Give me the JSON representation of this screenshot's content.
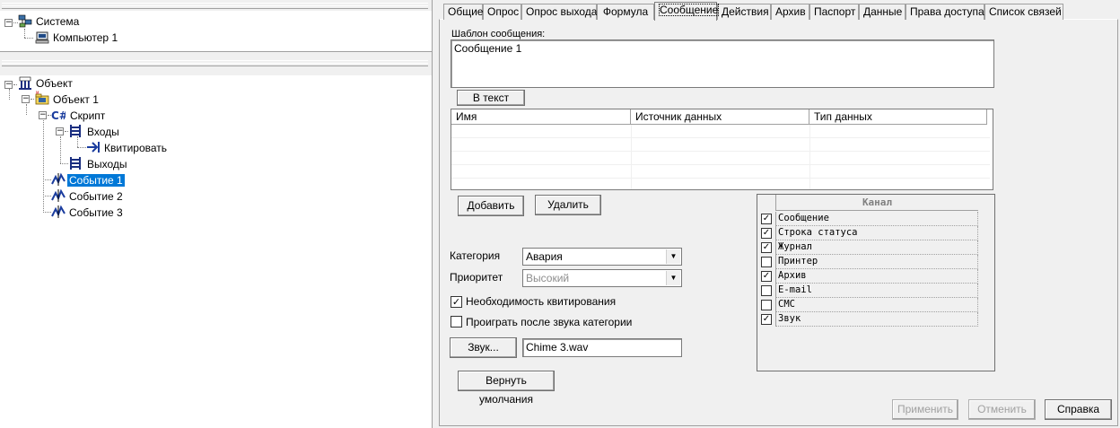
{
  "tree_top": {
    "nodes": [
      {
        "label": "Система",
        "icon": "network-icon"
      },
      {
        "label": "Компьютер 1",
        "icon": "computer-icon"
      }
    ]
  },
  "tree_bottom": {
    "nodes": [
      {
        "label": "Объект",
        "icon": "object-root-icon"
      },
      {
        "label": "Объект 1",
        "icon": "object-icon"
      },
      {
        "label": "Скрипт",
        "icon": "csharp-icon"
      },
      {
        "label": "Входы",
        "icon": "inputs-icon"
      },
      {
        "label": "Квитировать",
        "icon": "arrow-input-icon"
      },
      {
        "label": "Выходы",
        "icon": "outputs-icon"
      },
      {
        "label": "Событие 1",
        "icon": "event-icon",
        "selected": true
      },
      {
        "label": "Событие 2",
        "icon": "event-icon"
      },
      {
        "label": "Событие 3",
        "icon": "event-icon"
      }
    ]
  },
  "tabs": [
    "Общие",
    "Опрос",
    "Опрос выхода",
    "Формула",
    "Сообщение",
    "Действия",
    "Архив",
    "Паспорт",
    "Данные",
    "Права доступа",
    "Список связей"
  ],
  "active_tab": "Сообщение",
  "message": {
    "template_label": "Шаблон сообщения:",
    "template_value": "Сообщение 1",
    "to_text_button": "В текст"
  },
  "table": {
    "columns": [
      "Имя",
      "Источник данных",
      "Тип данных"
    ],
    "rows": []
  },
  "buttons": {
    "add": "Добавить",
    "delete": "Удалить",
    "sound": "Звук...",
    "restore_defaults": "Вернуть умолчания",
    "apply": "Применить",
    "cancel": "Отменить",
    "help": "Справка"
  },
  "category": {
    "label": "Категория",
    "value": "Авария"
  },
  "priority": {
    "label": "Приоритет",
    "value": "Высокий"
  },
  "need_ack": {
    "label": "Необходимость квитирования",
    "checked": true
  },
  "play_after": {
    "label": "Проиграть после звука категории",
    "checked": false
  },
  "sound_file": "Chime 3.wav",
  "channels": {
    "header": "Канал",
    "items": [
      {
        "label": "Сообщение",
        "checked": true
      },
      {
        "label": "Строка статуса",
        "checked": true
      },
      {
        "label": "Журнал",
        "checked": true
      },
      {
        "label": "Принтер",
        "checked": false
      },
      {
        "label": "Архив",
        "checked": true
      },
      {
        "label": "E-mail",
        "checked": false
      },
      {
        "label": "СМС",
        "checked": false
      },
      {
        "label": "Звук",
        "checked": true
      }
    ]
  }
}
